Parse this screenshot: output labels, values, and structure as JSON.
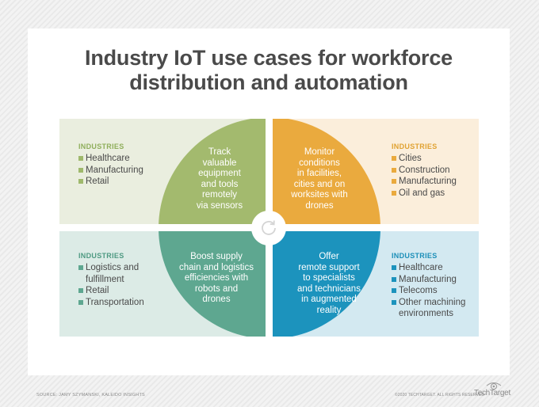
{
  "title_line1": "Industry IoT use cases for workforce",
  "title_line2": "distribution and automation",
  "colors": {
    "green": "#a3ba6e",
    "orange": "#eaaa3e",
    "teal": "#5ea790",
    "blue": "#1c93bd"
  },
  "quadrants": [
    {
      "position": "top-left",
      "color_name": "green",
      "use_case": [
        "Track",
        "valuable",
        "equipment",
        "and tools",
        "remotely",
        "via sensors"
      ],
      "industries_header": "INDUSTRIES",
      "industries": [
        "Healthcare",
        "Manufacturing",
        "Retail"
      ]
    },
    {
      "position": "top-right",
      "color_name": "orange",
      "use_case": [
        "Monitor",
        "conditions",
        "in facilities,",
        "cities and on",
        "worksites with",
        "drones"
      ],
      "industries_header": "INDUSTRIES",
      "industries": [
        "Cities",
        "Construction",
        "Manufacturing",
        "Oil and gas"
      ]
    },
    {
      "position": "bottom-left",
      "color_name": "teal",
      "use_case": [
        "Boost supply",
        "chain and logistics",
        "efficiencies with",
        "robots and",
        "drones"
      ],
      "industries_header": "INDUSTRIES",
      "industries": [
        "Logistics and fulfillment",
        "Retail",
        "Transportation"
      ]
    },
    {
      "position": "bottom-right",
      "color_name": "blue",
      "use_case": [
        "Offer",
        "remote support",
        "to specialists",
        "and technicians",
        "in augmented",
        "reality"
      ],
      "industries_header": "INDUSTRIES",
      "industries": [
        "Healthcare",
        "Manufacturing",
        "Telecoms",
        "Other machining environments"
      ]
    }
  ],
  "center_icon": "refresh-cycle-icon",
  "footer": {
    "source": "SOURCE: JAMY SZYMANSKI, KALEIDO INSIGHTS",
    "copyright": "©2020 TECHTARGET. ALL RIGHTS RESERVED",
    "brand": "TechTarget",
    "brand_icon": "techtarget-eye-icon"
  }
}
